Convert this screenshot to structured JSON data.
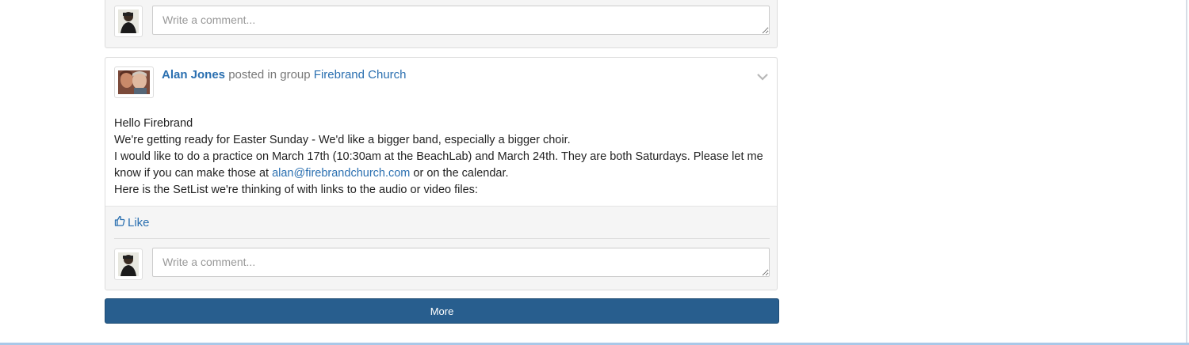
{
  "top_comment": {
    "placeholder": "Write a comment..."
  },
  "post": {
    "author": "Alan Jones",
    "verb": "posted in group",
    "group": "Firebrand Church",
    "lines": {
      "greeting": "Hello Firebrand",
      "line1": "We're getting ready for Easter Sunday - We'd like a bigger band, especially a bigger choir.",
      "line2_start": "I would like to do a practice on March 17th (10:30am at the BeachLab) and March 24th. They are both Saturdays. Please let me know if you can make those at ",
      "email": "alan@firebrandchurch.com",
      "line2_end": " or on the calendar.",
      "line3": "Here is the SetList we're thinking of with links to the audio or video files:"
    },
    "like_label": "Like",
    "comment_placeholder": "Write a comment..."
  },
  "more_button": "More",
  "icons": {
    "like": "thumbs-up-icon",
    "menu": "chevron-down-icon"
  },
  "colors": {
    "link": "#2a6fb0",
    "button": "#285e8e"
  }
}
